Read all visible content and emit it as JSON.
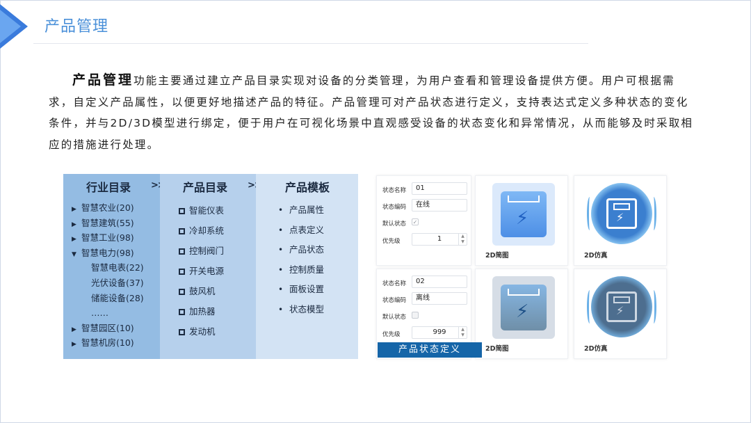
{
  "header": {
    "title": "产品管理",
    "accent": "#3a7bdc",
    "title_color": "#4a90d9"
  },
  "intro": {
    "lead": "产品管理",
    "text": "功能主要通过建立产品目录实现对设备的分类管理，为用户查看和管理设备提供方便。用户可根据需求，自定义产品属性，以便更好地描述产品的特征。产品管理可对产品状态进行定义，支持表达式定义多种状态的变化条件，并与2D/3D模型进行绑定，便于用户在可视化场景中直观感受设备的状态变化和异常情况，从而能够及时采取相应的措施进行处理。"
  },
  "tree": {
    "headers": [
      "行业目录",
      "产品目录",
      "产品模板"
    ],
    "separator": ">>",
    "industries": [
      {
        "icon": "triangle-right-icon",
        "label": "智慧农业",
        "count": "(20)"
      },
      {
        "icon": "triangle-right-icon",
        "label": "智慧建筑",
        "count": "(55)"
      },
      {
        "icon": "triangle-right-icon",
        "label": "智慧工业",
        "count": "(98)"
      },
      {
        "icon": "triangle-down-icon",
        "label": "智慧电力",
        "count": "(98)"
      },
      {
        "icon": "",
        "label": "智慧电表",
        "count": "(22)",
        "sub": true
      },
      {
        "icon": "",
        "label": "光伏设备",
        "count": "(37)",
        "sub": true
      },
      {
        "icon": "",
        "label": "储能设备",
        "count": "(28)",
        "sub": true
      },
      {
        "icon": "",
        "label": "……",
        "count": "",
        "sub": true
      },
      {
        "icon": "triangle-right-icon",
        "label": "智慧园区",
        "count": "(10)"
      },
      {
        "icon": "triangle-right-icon",
        "label": "智慧机房",
        "count": "(10)"
      }
    ],
    "products": [
      "智能仪表",
      "冷却系统",
      "控制阀门",
      "开关电源",
      "鼓风机",
      "加热器",
      "发动机"
    ],
    "templates": [
      "产品属性",
      "点表定义",
      "产品状态",
      "控制质量",
      "面板设置",
      "状态模型"
    ]
  },
  "states": {
    "labels": {
      "name": "状态名称",
      "code": "状态编码",
      "default": "默认状态",
      "priority": "优先级"
    },
    "rows": [
      {
        "name": "01",
        "code": "在线",
        "default_checked": true,
        "priority": "1",
        "cap_2d": "2D简图",
        "cap_sim": "2D仿真"
      },
      {
        "name": "02",
        "code": "离线",
        "default_checked": false,
        "priority": "999",
        "cap_2d": "2D简图",
        "cap_sim": "2D仿真"
      }
    ],
    "banner": "产品状态定义",
    "banner_color": "#1565a8"
  }
}
